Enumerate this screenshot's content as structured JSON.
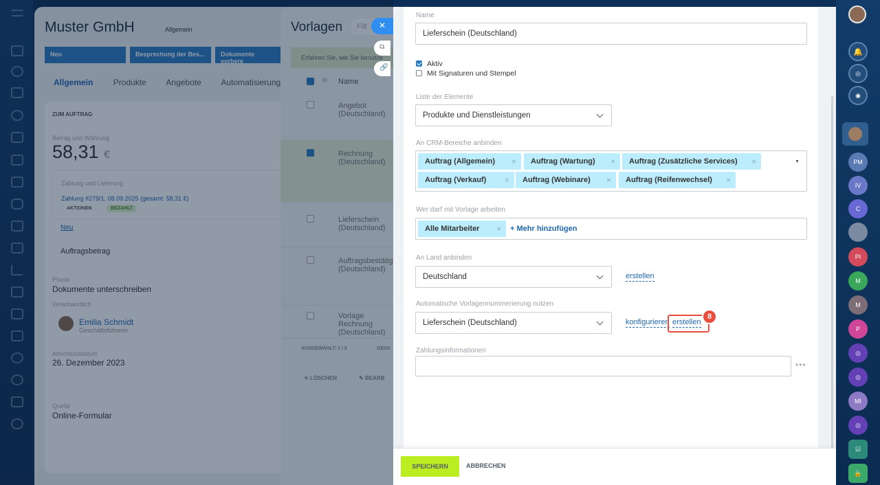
{
  "left_rail": {
    "icons": [
      "menu-icon",
      "home-icon",
      "goals-icon",
      "doc-icon",
      "people-icon",
      "file-icon",
      "car-icon",
      "chat-icon",
      "messages-icon",
      "calendar-icon",
      "tasks-icon",
      "chart-icon",
      "filter-icon",
      "terminal-icon",
      "cart-icon",
      "target-icon",
      "help-icon",
      "pen-icon",
      "user-icon"
    ]
  },
  "crm": {
    "title": "Muster GmbH",
    "pipeline": "Allgemein",
    "stages": [
      "Neu",
      "Besprechung der Bes...",
      "Dokumente vorbere"
    ],
    "tabs": [
      "Allgemein",
      "Produkte",
      "Angebote",
      "Automatisierung"
    ],
    "section": "ZUM AUFTRAG",
    "amount_label": "Betrag und Währung",
    "amount": "58,31",
    "currency": "€",
    "payment_label": "Zahlung und Lieferung",
    "payment": "Zahlung #279/1, 08.09.2025 (gesamt: 58,31 €)",
    "actions": "AKTIONEN",
    "paid": "BEZAHLT",
    "new_link": "Neu",
    "order_amount": "Auftragsbetrag",
    "phase_label": "Phase",
    "phase": "Dokumente unterschreiben",
    "resp_label": "Verantwortlich",
    "resp_name": "Emilia Schmidt",
    "resp_role": "Geschäftsführerin",
    "date_label": "Abschlussdatum",
    "date": "26. Dezember 2023",
    "source_label": "Quelle",
    "source": "Online-Formular"
  },
  "templates": {
    "title": "Vorlagen",
    "filter_placeholder": "Filt",
    "info": "Erfahren Sie, wie Sie benutze",
    "col_name": "Name",
    "rows": [
      "Angebot (Deutschland)",
      "Rechnung (Deutschland)",
      "Lieferschein (Deutschland)",
      "Auftragsbestätigung (Deutschland)",
      "Vorlage Rechnung (Deutschland)"
    ],
    "selected": "AUSGEWÄHLT: 1 / 5",
    "total": "GESA",
    "delete": "LÖSCHEN",
    "edit": "BEARB"
  },
  "form": {
    "name_label": "Name",
    "name_value": "Lieferschein (Deutschland)",
    "active_label": "Aktiv",
    "signature_label": "Mit Signaturen und Stempel",
    "list_label": "Liste der Elemente",
    "list_value": "Produkte und Dienstleistungen",
    "crm_label": "An CRM-Bereiche anbinden",
    "crm_tags": [
      "Auftrag (Allgemein)",
      "Auftrag (Wartung)",
      "Auftrag (Zusätzliche Services)",
      "Auftrag (Verkauf)",
      "Auftrag (Webinare)",
      "Auftrag (Reifenwechsel)"
    ],
    "who_label": "Wer darf mit Vorlage arbeiten",
    "who_tag": "Alle Mitarbeiter",
    "who_add": "+ Mehr hinzufügen",
    "country_label": "An Land anbinden",
    "country_value": "Deutschland",
    "country_create": "erstellen",
    "numbering_label": "Automatische Vorlagennummerierung nutzen",
    "numbering_value": "Lieferschein (Deutschland)",
    "configure": "konfigurieren",
    "create": "erstellen",
    "step_badge": "8",
    "payment_label": "Zahlungsinformationen",
    "payment_value": ""
  },
  "footer": {
    "save": "SPEICHERN",
    "cancel": "ABBRECHEN"
  },
  "right_rail": {
    "items": [
      "bell-icon",
      "activity-icon",
      "chat-icon",
      "avatar",
      "PM",
      "IV",
      "C",
      "avatar",
      "PI",
      "M",
      "M",
      "P",
      "bot-icon",
      "bot-icon",
      "MI",
      "bot-icon",
      "check-icon",
      "lock-icon"
    ]
  },
  "colors": {
    "accent": "#2067b0",
    "save": "#bbed21",
    "tag": "#bcedfc",
    "badge": "#e84d3d"
  }
}
